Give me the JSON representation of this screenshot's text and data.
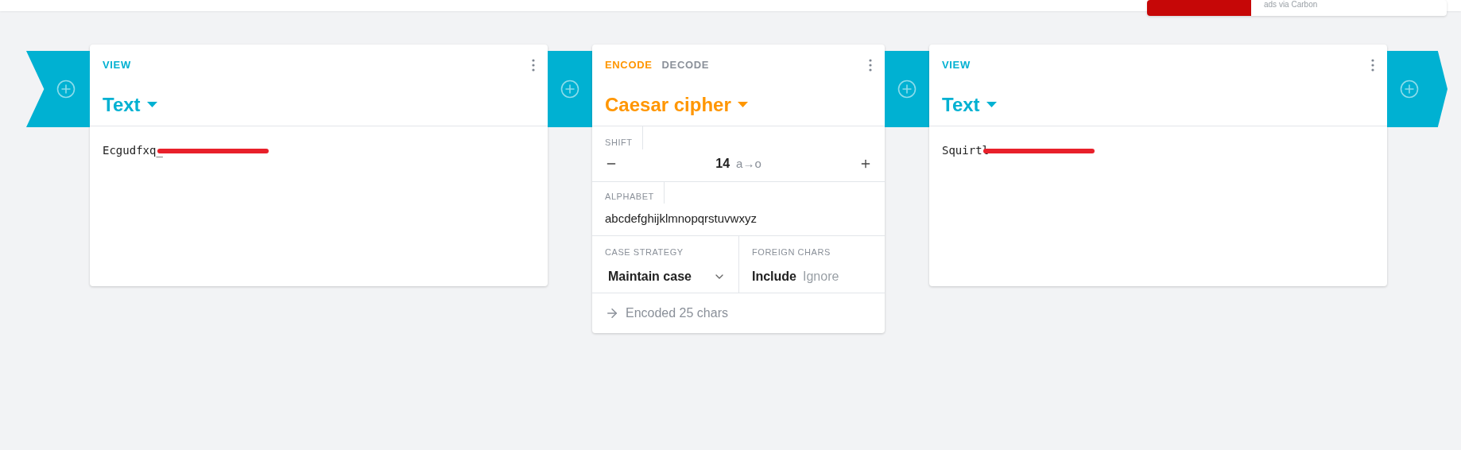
{
  "header": {
    "ad": {
      "text": "ads via Carbon"
    }
  },
  "chain": [
    {
      "kind": "view",
      "label": "VIEW",
      "title": "Text",
      "content": "Ecgudfxq_"
    },
    {
      "kind": "cipher",
      "modes": [
        {
          "label": "ENCODE",
          "selected": true
        },
        {
          "label": "DECODE",
          "selected": false
        }
      ],
      "title": "Caesar cipher",
      "shift": {
        "label": "SHIFT",
        "value": "14",
        "mapping": "a→o"
      },
      "alphabet": {
        "label": "ALPHABET",
        "value": "abcdefghijklmnopqrstuvwxyz"
      },
      "case_strategy": {
        "label": "CASE STRATEGY",
        "value": "Maintain case"
      },
      "foreign_chars": {
        "label": "FOREIGN CHARS",
        "options": [
          {
            "label": "Include",
            "selected": true
          },
          {
            "label": "Ignore",
            "selected": false
          }
        ]
      },
      "status": "Encoded 25 chars"
    },
    {
      "kind": "view",
      "label": "VIEW",
      "title": "Text",
      "content": "Squirtl"
    }
  ]
}
